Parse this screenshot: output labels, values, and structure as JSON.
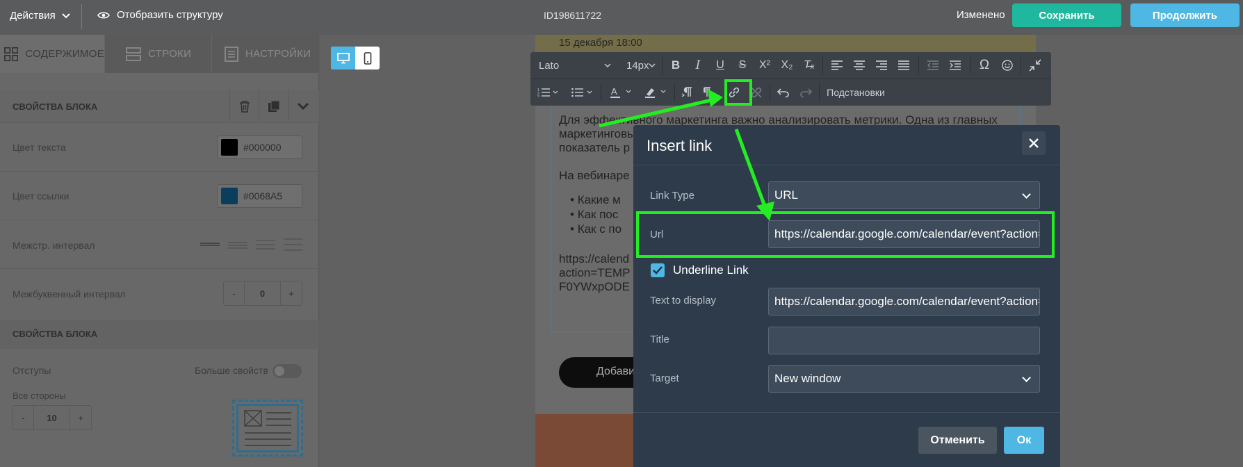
{
  "topbar": {
    "actions_label": "Действия",
    "structure_label": "Отобразить структуру",
    "doc_id": "ID198611722",
    "status": "Изменено",
    "save_label": "Сохранить",
    "continue_label": "Продолжить"
  },
  "left_panel": {
    "tabs": [
      {
        "label": "СОДЕРЖИМОЕ",
        "icon": "grid-icon",
        "active": true
      },
      {
        "label": "СТРОКИ",
        "icon": "rows-icon",
        "active": false
      },
      {
        "label": "НАСТРОЙКИ",
        "icon": "settings-doc-icon",
        "active": false
      }
    ],
    "block_props_title": "СВОЙСТВА БЛОКА",
    "text_color_label": "Цвет текста",
    "text_color_value": "#000000",
    "link_color_label": "Цвет ссылки",
    "link_color_value": "#0068A5",
    "line_spacing_label": "Межстр. интервал",
    "letter_spacing_label": "Межбуквенный интервал",
    "letter_spacing_minus": "-",
    "letter_spacing_value": "0",
    "letter_spacing_plus": "+",
    "block_props_title_2": "СВОЙСТВА БЛОКА",
    "padding_label": "Отступы",
    "more_props_label": "Больше свойств",
    "all_sides_label": "Все стороны",
    "padding_minus": "-",
    "padding_value": "10",
    "padding_plus": "+"
  },
  "email": {
    "date": "15 декабря 18:00",
    "para1_line1": "Для эффективного маркетинга важно анализировать метрики. Одна из главных",
    "para1_line2": "маркетинговых",
    "para1_line3": "показатель р",
    "para2": "На вебинаре",
    "bullets": [
      "Какие м",
      "Как пос",
      "Как с по"
    ],
    "link_line1": "https://calend",
    "link_line2": "action=TEMP",
    "link_line3": "F0YWxpODE",
    "button_label": "Добави"
  },
  "toolbar": {
    "font": "Lato",
    "size": "14px",
    "merge_tags_label": "Подстановки"
  },
  "modal": {
    "title": "Insert link",
    "link_type_label": "Link Type",
    "link_type_value": "URL",
    "url_label": "Url",
    "url_value": "https://calendar.google.com/calendar/event?action=TEMPLATE",
    "underline_label": "Underline Link",
    "underline_checked": true,
    "text_label": "Text to display",
    "text_value": "https://calendar.google.com/calendar/event?action=TEMPLATE",
    "title_label": "Title",
    "title_value": "",
    "target_label": "Target",
    "target_value": "New window",
    "cancel_label": "Отменить",
    "ok_label": "Ок"
  },
  "colors": {
    "accent_green": "#1fb89e",
    "accent_blue": "#4fb7e4",
    "highlight": "#22ee22",
    "modal_bg": "#2e3b4a"
  }
}
